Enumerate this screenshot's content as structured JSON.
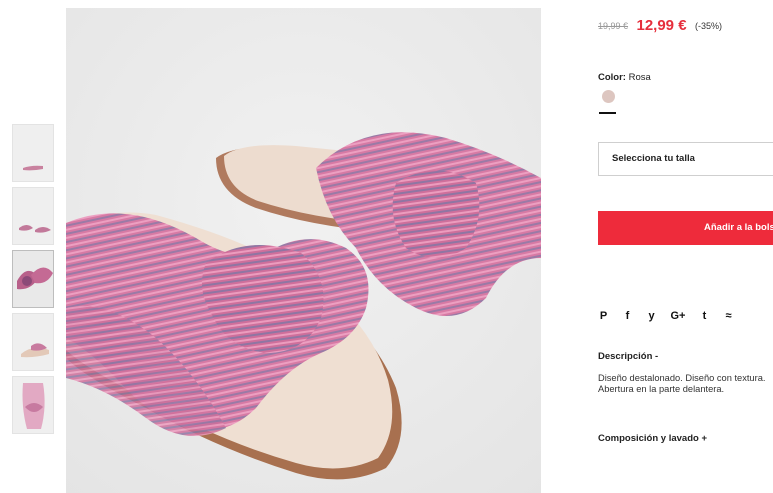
{
  "price": {
    "old": "19,99 €",
    "sale": "12,99 €",
    "discount": "(-35%)"
  },
  "color": {
    "label": "Color:",
    "value": "Rosa",
    "swatch_color": "#ddc6c0"
  },
  "size_select": {
    "label": "Selecciona tu talla"
  },
  "add_button": {
    "label": "Añadir a la bolsa",
    "color": "#ee2b3b"
  },
  "share": {
    "icons": [
      "pinterest-icon",
      "facebook-icon",
      "twitter-icon",
      "google-plus-icon",
      "tumblr-icon",
      "email-icon"
    ],
    "glyphs": [
      "P",
      "f",
      "y",
      "G+",
      "t",
      "≈"
    ]
  },
  "description": {
    "title": "Descripción -",
    "line1": "Diseño destalonado. Diseño con textura.",
    "line2": "Abertura en la parte delantera."
  },
  "composition": {
    "title": "Composición y lavado +"
  },
  "thumbnails": {
    "count": 5,
    "active_index": 2
  }
}
